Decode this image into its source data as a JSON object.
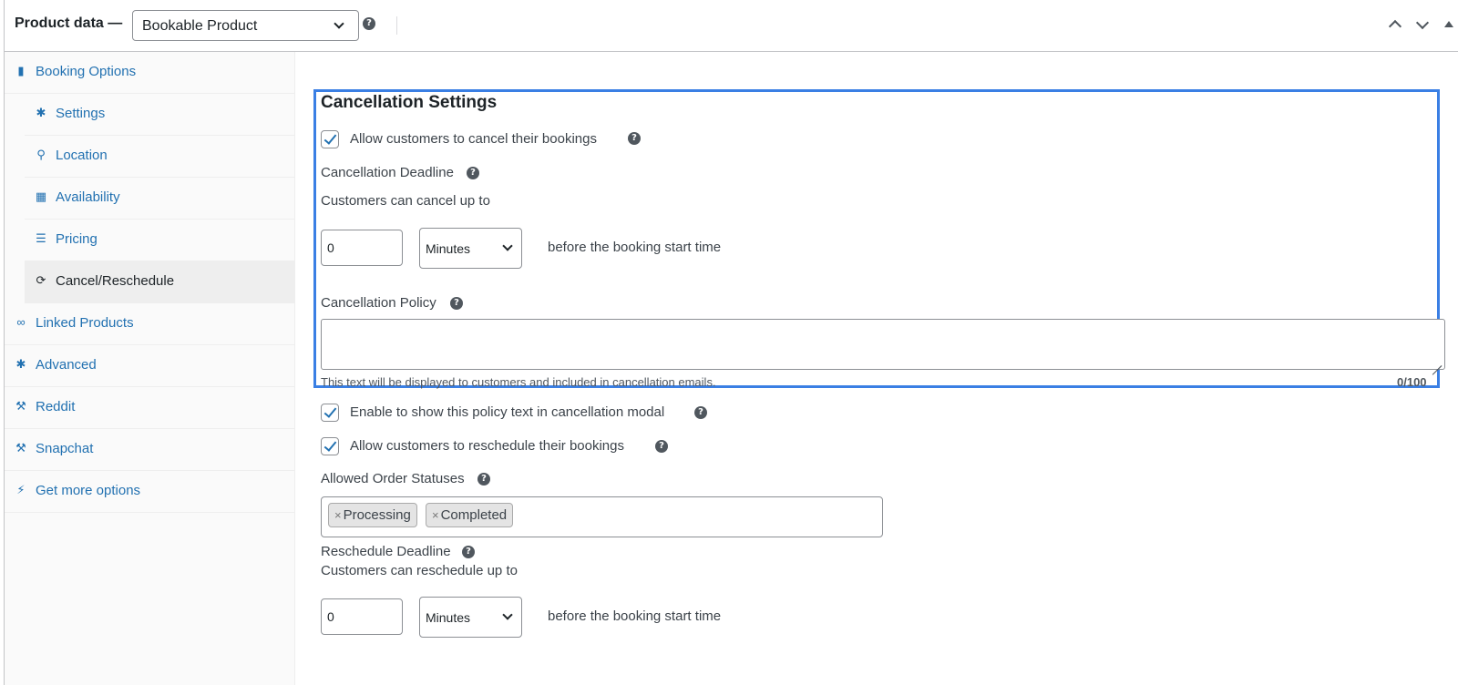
{
  "header": {
    "title": "Product data —",
    "product_type": "Bookable Product",
    "help": "?"
  },
  "sidebar": {
    "items": [
      {
        "label": "Booking Options",
        "icon": "book-icon"
      },
      {
        "label": "Settings",
        "icon": "gear-icon"
      },
      {
        "label": "Location",
        "icon": "location-pin-icon"
      },
      {
        "label": "Availability",
        "icon": "calendar-icon"
      },
      {
        "label": "Pricing",
        "icon": "list-icon"
      },
      {
        "label": "Cancel/Reschedule",
        "icon": "refresh-icon"
      },
      {
        "label": "Linked Products",
        "icon": "link-icon"
      },
      {
        "label": "Advanced",
        "icon": "gear-icon"
      },
      {
        "label": "Reddit",
        "icon": "wrench-icon"
      },
      {
        "label": "Snapchat",
        "icon": "wrench-icon"
      },
      {
        "label": "Get more options",
        "icon": "plugin-icon"
      }
    ]
  },
  "cancellation": {
    "heading": "Cancellation Settings",
    "allow_cancel_label": "Allow customers to cancel their bookings",
    "allow_cancel_checked": true,
    "deadline_label": "Cancellation Deadline",
    "deadline_sub": "Customers can cancel up to",
    "deadline_value": "0",
    "deadline_unit": "Minutes",
    "deadline_suffix": "before the booking start time",
    "policy_label": "Cancellation Policy",
    "policy_value": "",
    "policy_desc": "This text will be displayed to customers and included in cancellation emails.",
    "policy_counter": "0/100"
  },
  "options": {
    "show_policy_label": "Enable to show this policy text in cancellation modal",
    "show_policy_checked": true,
    "allow_reschedule_label": "Allow customers to reschedule their bookings",
    "allow_reschedule_checked": true,
    "statuses_label": "Allowed Order Statuses",
    "statuses": [
      "Processing",
      "Completed"
    ],
    "chip_remove": "×",
    "reschedule_label": "Reschedule Deadline",
    "reschedule_sub": "Customers can reschedule up to",
    "reschedule_value": "0",
    "reschedule_unit": "Minutes",
    "reschedule_suffix": "before the booking start time"
  },
  "colors": {
    "link": "#2271b1",
    "focus_outline": "#3a7fe4",
    "text": "#1d2327"
  }
}
